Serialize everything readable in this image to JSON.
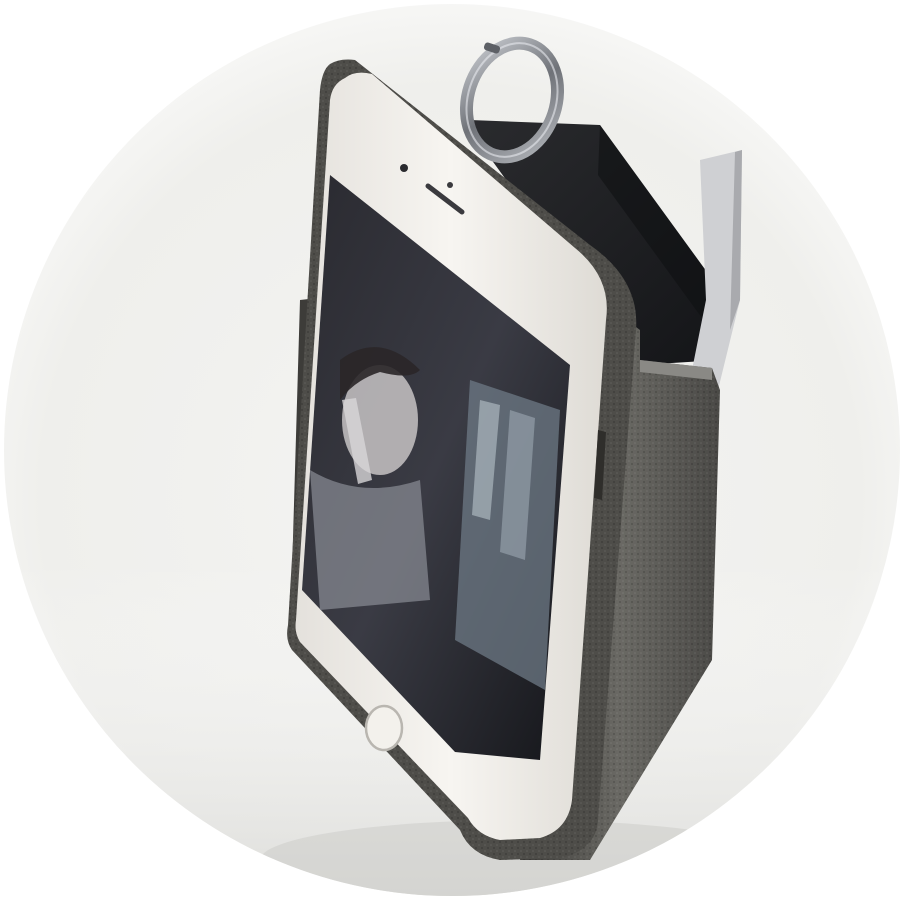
{
  "scene": {
    "subject": "phone-in-leather-case",
    "colors": {
      "page_background": "#ffffff",
      "backdrop_light": "#f4f4f2",
      "backdrop_shadow": "#d9d9d6",
      "leather_case": "#5a5955",
      "leather_case_dark": "#2b2b2a",
      "case_interior": "#1e1f22",
      "phone_body": "#f1eee9",
      "phone_bezel": "#e4e1dc",
      "screen_dark": "#1c1c20",
      "ring_metal": "#8a8d92",
      "card_slip": "#cfd0d3"
    },
    "icons": [
      "home-button-icon",
      "metal-ring-icon",
      "speaker-grille-icon",
      "front-camera-icon"
    ]
  }
}
